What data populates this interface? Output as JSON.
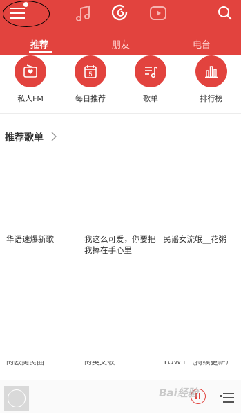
{
  "header": {
    "icons": [
      "menu-icon",
      "music-note-icon",
      "netease-cloud-icon",
      "video-play-icon",
      "search-icon"
    ],
    "tabs": [
      {
        "label": "推荐",
        "active": true
      },
      {
        "label": "朋友",
        "active": false
      },
      {
        "label": "电台",
        "active": false
      }
    ]
  },
  "quick_entries": [
    {
      "label": "私人FM",
      "icon": "radio-icon"
    },
    {
      "label": "每日推荐",
      "icon": "calendar-icon",
      "day": "5"
    },
    {
      "label": "歌单",
      "icon": "playlist-icon"
    },
    {
      "label": "排行榜",
      "icon": "chart-bar-icon"
    }
  ],
  "section": {
    "title": "推荐歌单"
  },
  "playlists_row1": [
    {
      "title": "华语速爆新歌"
    },
    {
      "title": "我这么可爱，你要把我捧在手心里"
    },
    {
      "title": "民谣女流氓__花粥"
    }
  ],
  "playlists_row2": [
    {
      "title": "的欧美民曲"
    },
    {
      "title": "的英文歌"
    },
    {
      "title": "TOW+（持续更新）"
    }
  ],
  "watermark": "Bai经验",
  "colors": {
    "accent": "#e2433e"
  }
}
